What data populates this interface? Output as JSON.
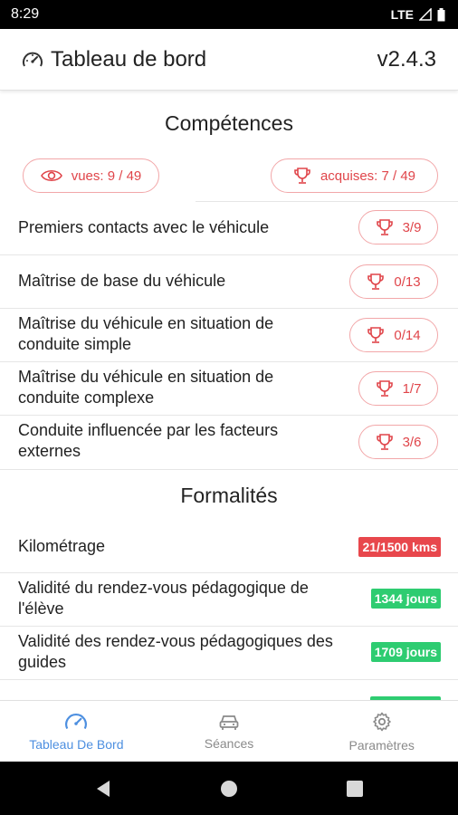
{
  "status_bar": {
    "time": "8:29",
    "network": "LTE"
  },
  "header": {
    "title": "Tableau de bord",
    "version": "v2.4.3",
    "icon": "speedometer-icon"
  },
  "competences": {
    "title": "Compétences",
    "vues": "vues: 9 / 49",
    "acquises": "acquises: 7 / 49",
    "items": [
      {
        "label": "Premiers contacts avec le véhicule",
        "value": "3/9"
      },
      {
        "label": "Maîtrise de base du véhicule",
        "value": "0/13"
      },
      {
        "label": "Maîtrise du véhicule en situation de conduite simple",
        "value": "0/14"
      },
      {
        "label": "Maîtrise du véhicule en situation de conduite complexe",
        "value": "1/7"
      },
      {
        "label": "Conduite influencée par les facteurs externes",
        "value": "3/6"
      }
    ]
  },
  "formalites": {
    "title": "Formalités",
    "items": [
      {
        "label": "Kilométrage",
        "value": "21/1500 kms",
        "color": "#e8474c"
      },
      {
        "label": "Validité du rendez-vous pédagogique de l'élève",
        "value": "1344 jours",
        "color": "#2ecc71"
      },
      {
        "label": "Validité des rendez-vous pédagogiques des guides",
        "value": "1709 jours",
        "color": "#2ecc71"
      }
    ]
  },
  "bottom_nav": {
    "items": [
      {
        "label": "Tableau De Bord",
        "icon": "speedometer-icon",
        "active": true
      },
      {
        "label": "Séances",
        "icon": "car-icon",
        "active": false
      },
      {
        "label": "Paramètres",
        "icon": "gear-icon",
        "active": false
      }
    ]
  },
  "colors": {
    "accent_red": "#e0454a",
    "accent_blue": "#4d8fe0",
    "success_green": "#2ecc71",
    "danger_red": "#e8474c"
  }
}
